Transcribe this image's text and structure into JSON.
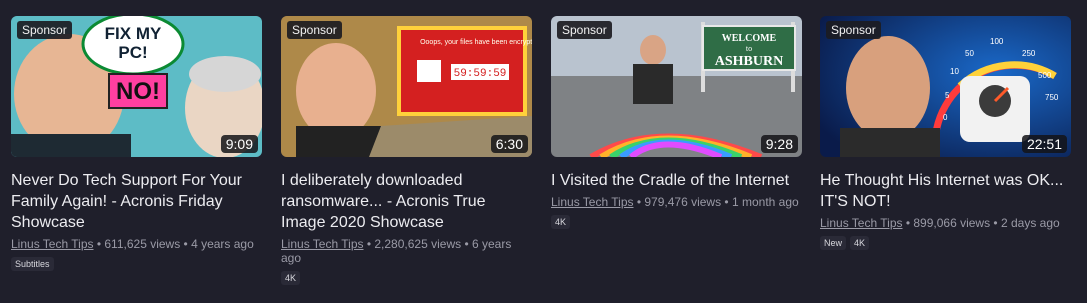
{
  "videos": [
    {
      "sponsor_label": "Sponsor",
      "duration": "9:09",
      "thumb_text": {
        "bubble": "FIX MY\nPC!",
        "shout": "NO!"
      },
      "title": "Never Do Tech Support For Your Family Again! - Acronis Friday Showcase",
      "channel": "Linus Tech Tips",
      "stats": "• 611,625 views • 4 years ago",
      "badges": [
        "Subtitles"
      ]
    },
    {
      "sponsor_label": "Sponsor",
      "duration": "6:30",
      "thumb_text": {
        "ransom": "Ooops, your files have been encrypted!",
        "timer": "59:59:59"
      },
      "title": "I deliberately downloaded ransomware... - Acronis True Image 2020 Showcase",
      "channel": "Linus Tech Tips",
      "stats": "• 2,280,625 views • 6 years ago",
      "badges": [
        "4K"
      ]
    },
    {
      "sponsor_label": "Sponsor",
      "duration": "9:28",
      "thumb_text": {
        "sign_top": "WELCOME",
        "sign_mid": "to",
        "sign_bottom": "ASHBURN"
      },
      "title": "I Visited the Cradle of the Internet",
      "channel": "Linus Tech Tips",
      "stats": "• 979,476 views • 1 month ago",
      "badges": [
        "4K"
      ]
    },
    {
      "sponsor_label": "Sponsor",
      "duration": "22:51",
      "thumb_text": {
        "gauge_labels": [
          "50",
          "100",
          "250",
          "500",
          "750",
          "10",
          "5",
          "0"
        ]
      },
      "title": "He Thought His Internet was OK... IT'S NOT!",
      "channel": "Linus Tech Tips",
      "stats": "• 899,066 views • 2 days ago",
      "badges": [
        "New",
        "4K"
      ]
    }
  ]
}
